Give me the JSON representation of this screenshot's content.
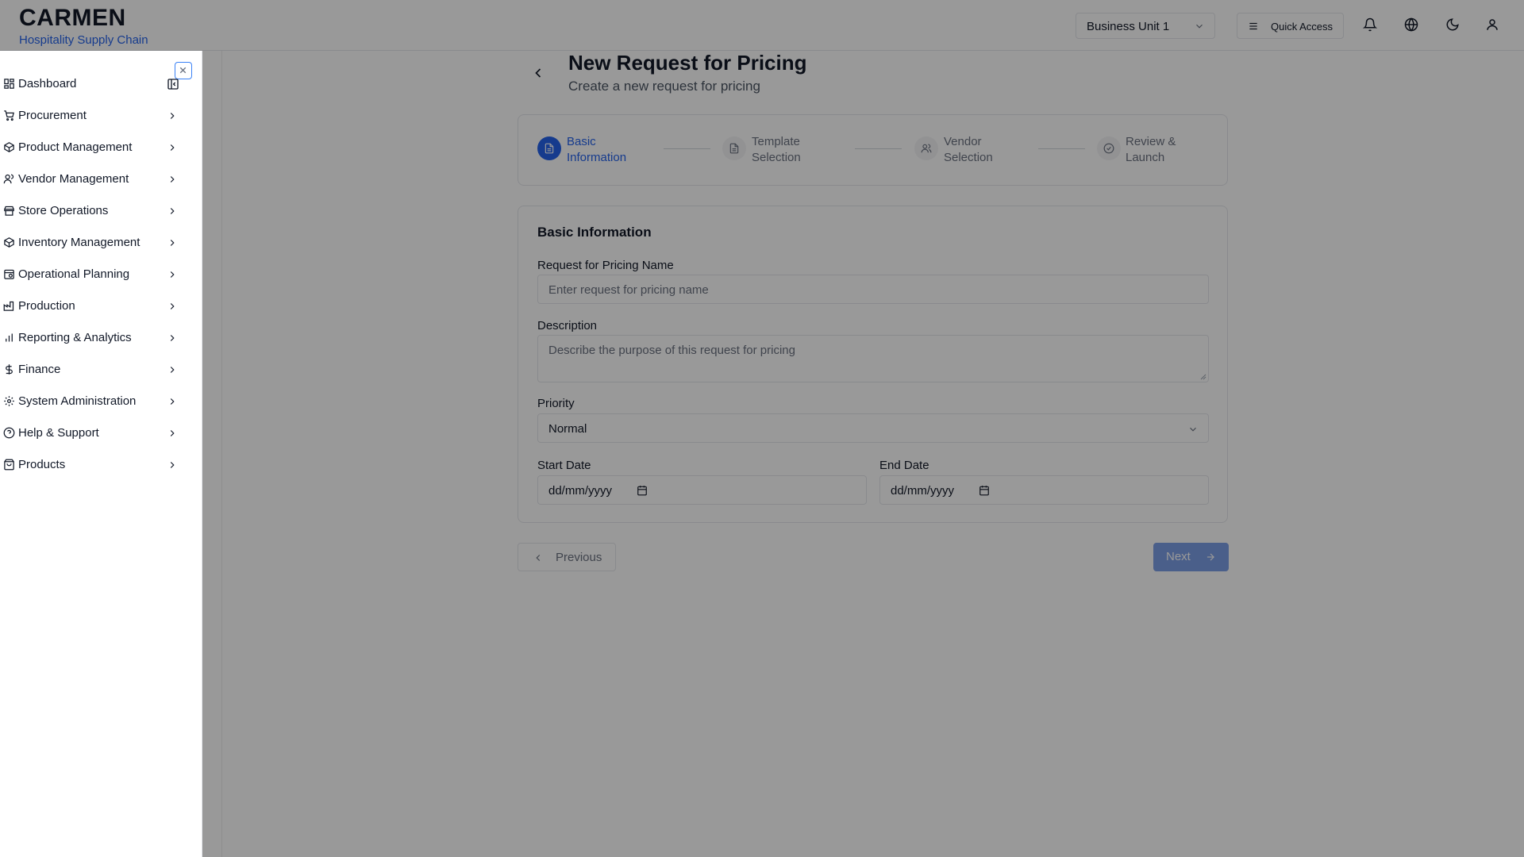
{
  "brand": {
    "title": "CARMEN",
    "subtitle": "Hospitality Supply Chain"
  },
  "header": {
    "business_unit": "Business Unit 1",
    "quick_access": "Quick Access",
    "icons": [
      "bell-icon",
      "globe-icon",
      "moon-icon",
      "user-icon"
    ]
  },
  "sidebar": {
    "items": [
      {
        "label": "Dashboard",
        "icon": "dashboard-icon"
      },
      {
        "label": "Procurement",
        "icon": "cart-icon"
      },
      {
        "label": "Product Management",
        "icon": "package-icon"
      },
      {
        "label": "Vendor Management",
        "icon": "users-icon"
      },
      {
        "label": "Store Operations",
        "icon": "store-icon"
      },
      {
        "label": "Inventory Management",
        "icon": "box-icon"
      },
      {
        "label": "Operational Planning",
        "icon": "calendar-clock-icon"
      },
      {
        "label": "Production",
        "icon": "factory-icon"
      },
      {
        "label": "Reporting & Analytics",
        "icon": "bar-chart-icon"
      },
      {
        "label": "Finance",
        "icon": "dollar-icon"
      },
      {
        "label": "System Administration",
        "icon": "gear-icon"
      },
      {
        "label": "Help & Support",
        "icon": "help-circle-icon"
      },
      {
        "label": "Products",
        "icon": "shopping-bag-icon"
      }
    ]
  },
  "page": {
    "title": "New Request for Pricing",
    "subtitle": "Create a new request for pricing"
  },
  "stepper": {
    "steps": [
      {
        "line1": "Basic",
        "line2": "Information",
        "active": true
      },
      {
        "line1": "Template",
        "line2": "Selection",
        "active": false
      },
      {
        "line1": "Vendor",
        "line2": "Selection",
        "active": false
      },
      {
        "line1": "Review &",
        "line2": "Launch",
        "active": false
      }
    ]
  },
  "form": {
    "section_title": "Basic Information",
    "name_label": "Request for Pricing Name",
    "name_placeholder": "Enter request for pricing name",
    "description_label": "Description",
    "description_placeholder": "Describe the purpose of this request for pricing",
    "priority_label": "Priority",
    "priority_value": "Normal",
    "start_date_label": "Start Date",
    "start_date_value": "dd/mm/yyyy",
    "end_date_label": "End Date",
    "end_date_value": "dd/mm/yyyy"
  },
  "actions": {
    "previous": "Previous",
    "next": "Next"
  },
  "colors": {
    "accent": "#2563eb",
    "next_button": "#7c9ee6",
    "overlay": "rgba(0,0,0,0.4)"
  }
}
